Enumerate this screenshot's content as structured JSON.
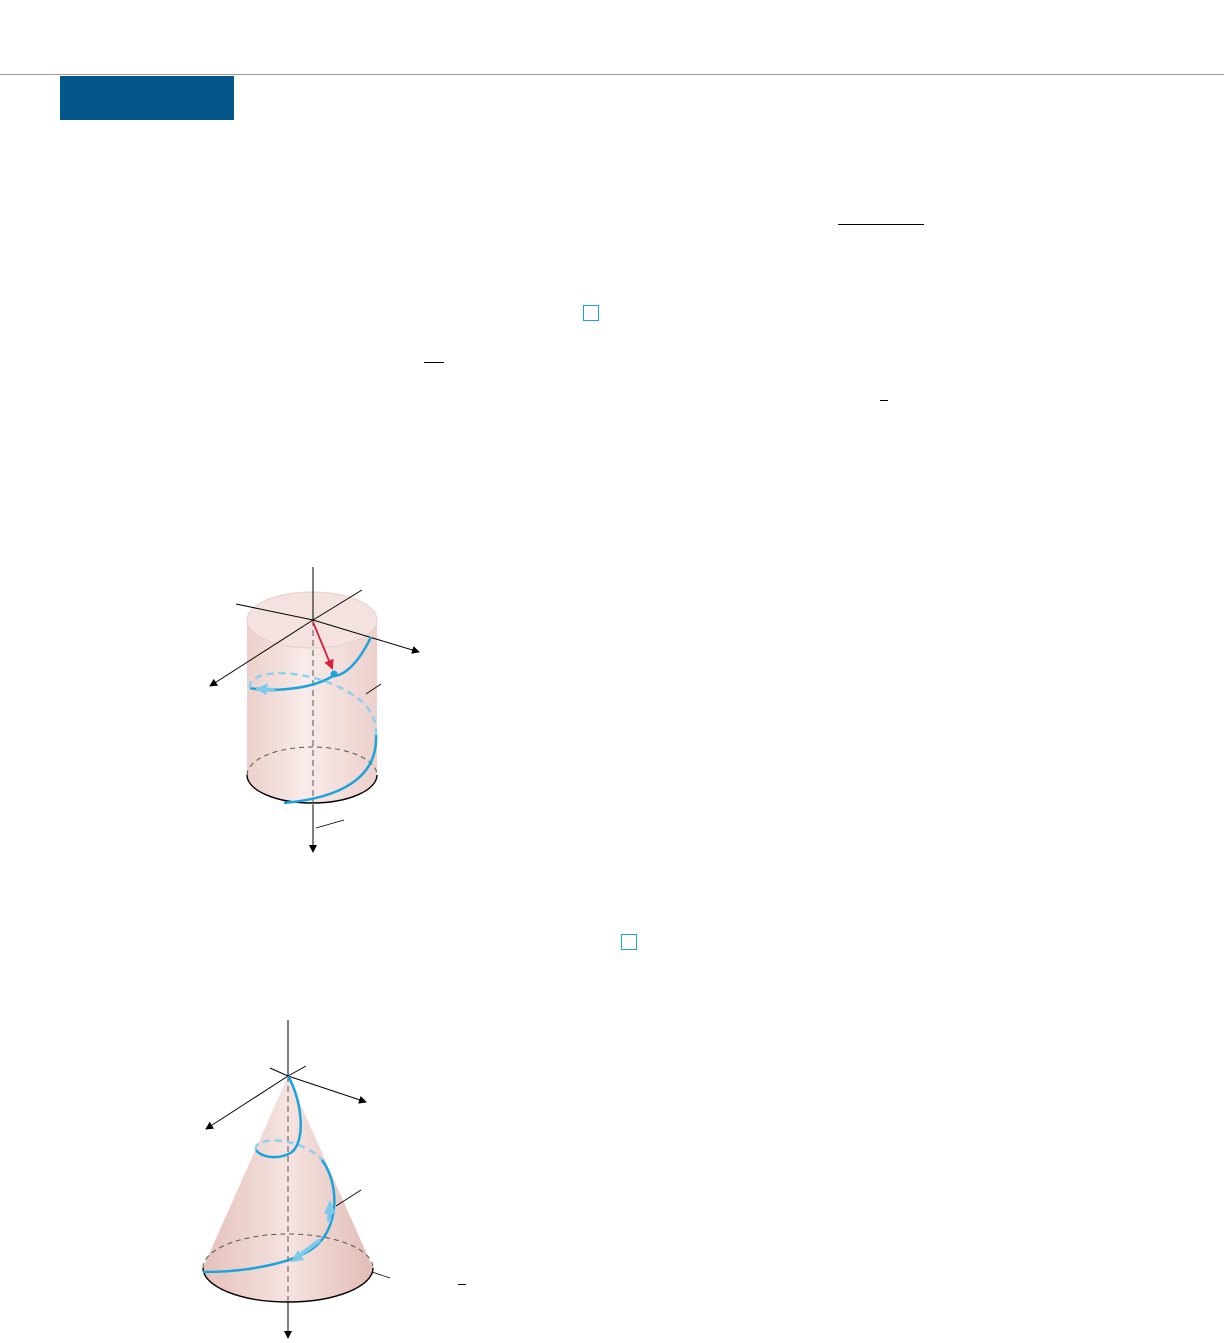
{
  "header": {
    "accent_color": "#04578a",
    "rule_color": "#9a9a9a"
  },
  "markers": {
    "end_box_color": "#1ba3dc"
  },
  "figures": {
    "cylinder_helix": {
      "surface_color": "#f2dcd8",
      "curve_color": "#1ba3dc",
      "position_vector_color": "#d81e3c"
    },
    "cone_helix": {
      "surface_color": "#eccfc9",
      "curve_color": "#1ba3dc"
    }
  }
}
